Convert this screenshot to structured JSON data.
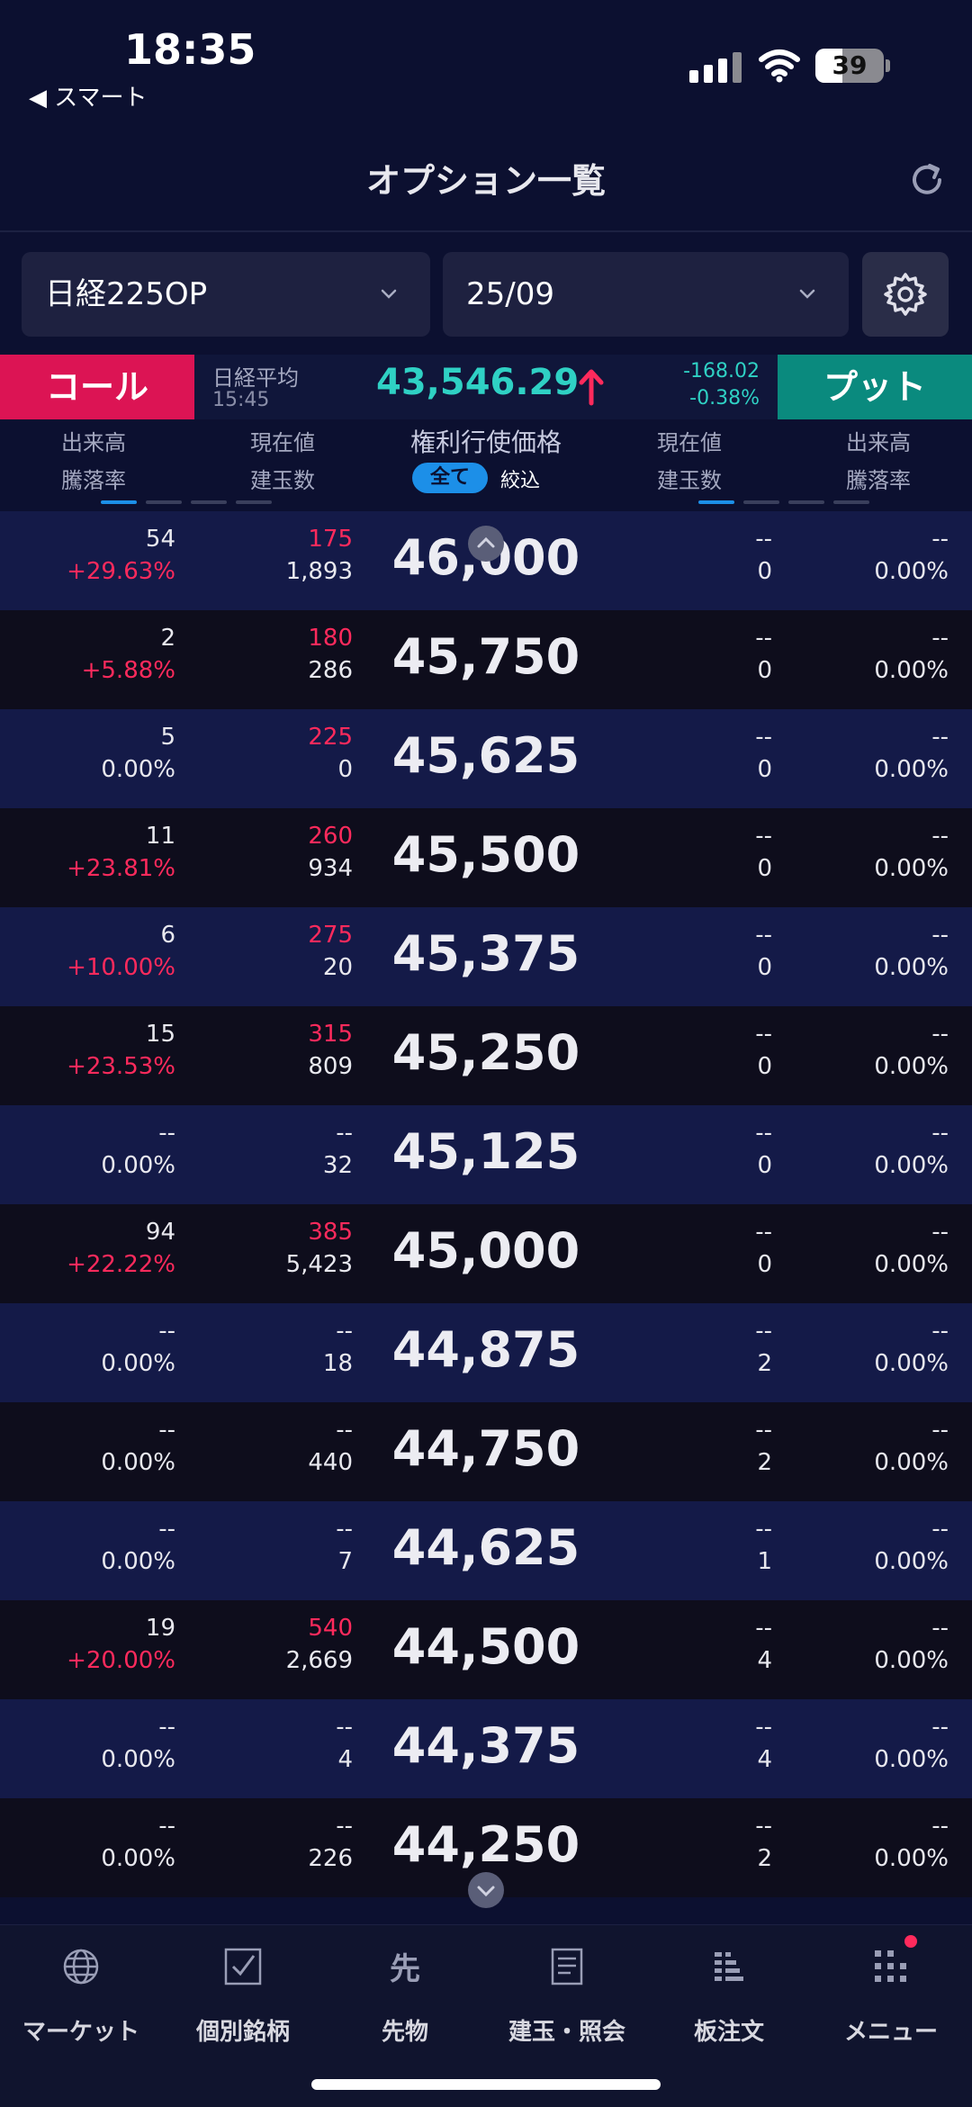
{
  "status": {
    "time": "18:35",
    "back_app": "◀ スマート",
    "battery": "39"
  },
  "header": {
    "title": "オプション一覧"
  },
  "selectors": {
    "product": "日経225OP",
    "month": "25/09"
  },
  "call_put": {
    "call_label": "コール",
    "put_label": "プット",
    "index_label": "日経平均",
    "index_time": "15:45",
    "index_value": "43,546.29",
    "index_change": "-168.02",
    "index_change_pct": "-0.38%"
  },
  "columns": {
    "call_volume": "出来高",
    "call_change_rate": "騰落率",
    "call_price": "現在値",
    "call_open_interest": "建玉数",
    "strike": "権利行使価格",
    "filter_all": "全て",
    "filter_narrow": "絞込",
    "put_price": "現在値",
    "put_open_interest": "建玉数",
    "put_volume": "出来高",
    "put_change_rate": "騰落率"
  },
  "rows": [
    {
      "strike": "46,000",
      "call_vol": "54",
      "call_chg": "+29.63%",
      "call_price": "175",
      "call_oi": "1,893",
      "put_price": "--",
      "put_oi": "0",
      "put_vol": "--",
      "put_chg": "0.00%"
    },
    {
      "strike": "45,750",
      "call_vol": "2",
      "call_chg": "+5.88%",
      "call_price": "180",
      "call_oi": "286",
      "put_price": "--",
      "put_oi": "0",
      "put_vol": "--",
      "put_chg": "0.00%"
    },
    {
      "strike": "45,625",
      "call_vol": "5",
      "call_chg": "0.00%",
      "call_price": "225",
      "call_oi": "0",
      "put_price": "--",
      "put_oi": "0",
      "put_vol": "--",
      "put_chg": "0.00%"
    },
    {
      "strike": "45,500",
      "call_vol": "11",
      "call_chg": "+23.81%",
      "call_price": "260",
      "call_oi": "934",
      "put_price": "--",
      "put_oi": "0",
      "put_vol": "--",
      "put_chg": "0.00%"
    },
    {
      "strike": "45,375",
      "call_vol": "6",
      "call_chg": "+10.00%",
      "call_price": "275",
      "call_oi": "20",
      "put_price": "--",
      "put_oi": "0",
      "put_vol": "--",
      "put_chg": "0.00%"
    },
    {
      "strike": "45,250",
      "call_vol": "15",
      "call_chg": "+23.53%",
      "call_price": "315",
      "call_oi": "809",
      "put_price": "--",
      "put_oi": "0",
      "put_vol": "--",
      "put_chg": "0.00%"
    },
    {
      "strike": "45,125",
      "call_vol": "--",
      "call_chg": "0.00%",
      "call_price": "--",
      "call_oi": "32",
      "put_price": "--",
      "put_oi": "0",
      "put_vol": "--",
      "put_chg": "0.00%"
    },
    {
      "strike": "45,000",
      "call_vol": "94",
      "call_chg": "+22.22%",
      "call_price": "385",
      "call_oi": "5,423",
      "put_price": "--",
      "put_oi": "0",
      "put_vol": "--",
      "put_chg": "0.00%"
    },
    {
      "strike": "44,875",
      "call_vol": "--",
      "call_chg": "0.00%",
      "call_price": "--",
      "call_oi": "18",
      "put_price": "--",
      "put_oi": "2",
      "put_vol": "--",
      "put_chg": "0.00%"
    },
    {
      "strike": "44,750",
      "call_vol": "--",
      "call_chg": "0.00%",
      "call_price": "--",
      "call_oi": "440",
      "put_price": "--",
      "put_oi": "2",
      "put_vol": "--",
      "put_chg": "0.00%"
    },
    {
      "strike": "44,625",
      "call_vol": "--",
      "call_chg": "0.00%",
      "call_price": "--",
      "call_oi": "7",
      "put_price": "--",
      "put_oi": "1",
      "put_vol": "--",
      "put_chg": "0.00%"
    },
    {
      "strike": "44,500",
      "call_vol": "19",
      "call_chg": "+20.00%",
      "call_price": "540",
      "call_oi": "2,669",
      "put_price": "--",
      "put_oi": "4",
      "put_vol": "--",
      "put_chg": "0.00%"
    },
    {
      "strike": "44,375",
      "call_vol": "--",
      "call_chg": "0.00%",
      "call_price": "--",
      "call_oi": "4",
      "put_price": "--",
      "put_oi": "4",
      "put_vol": "--",
      "put_chg": "0.00%"
    },
    {
      "strike": "44,250",
      "call_vol": "--",
      "call_chg": "0.00%",
      "call_price": "--",
      "call_oi": "226",
      "put_price": "--",
      "put_oi": "2",
      "put_vol": "--",
      "put_chg": "0.00%"
    }
  ],
  "nav": {
    "market": "マーケット",
    "stocks": "個別銘柄",
    "futures": "先物",
    "positions": "建玉・照会",
    "board_order": "板注文",
    "menu": "メニュー"
  },
  "colors": {
    "call": "#dc1454",
    "put": "#0a8a7e",
    "up_red": "#ff2a5c",
    "index_teal": "#2fd1c4",
    "accent_blue": "#1c8fe8"
  }
}
